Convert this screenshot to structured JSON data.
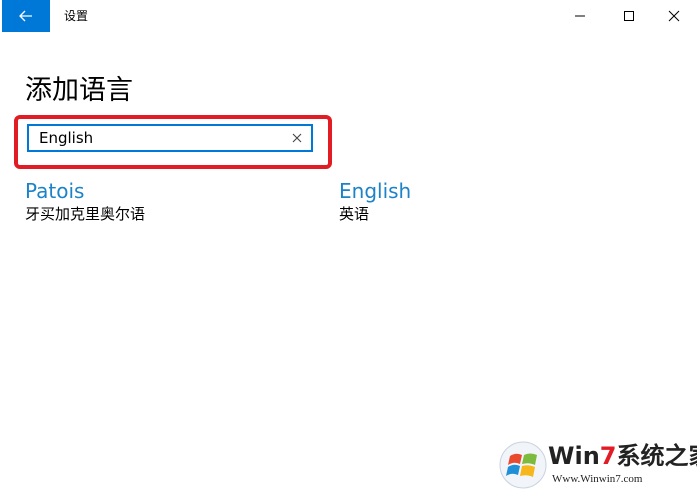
{
  "window": {
    "title": "设置"
  },
  "page": {
    "title": "添加语言"
  },
  "search": {
    "value": "English"
  },
  "results": [
    {
      "name": "Patois",
      "native": "牙买加克里奥尔语"
    },
    {
      "name": "English",
      "native": "英语"
    }
  ],
  "watermark": {
    "brand_win": "Win",
    "brand_seven": "7",
    "brand_rest": "系统之家",
    "url": "Www.Winwin7.com"
  },
  "colors": {
    "accent": "#0078d7",
    "link": "#1d83c8",
    "highlight_box": "#e11c24"
  },
  "icons": {
    "back": "arrow-left-icon",
    "minimize": "minimize-icon",
    "maximize": "maximize-icon",
    "close": "close-icon",
    "clear": "clear-x-icon",
    "logo": "windows-logo"
  }
}
